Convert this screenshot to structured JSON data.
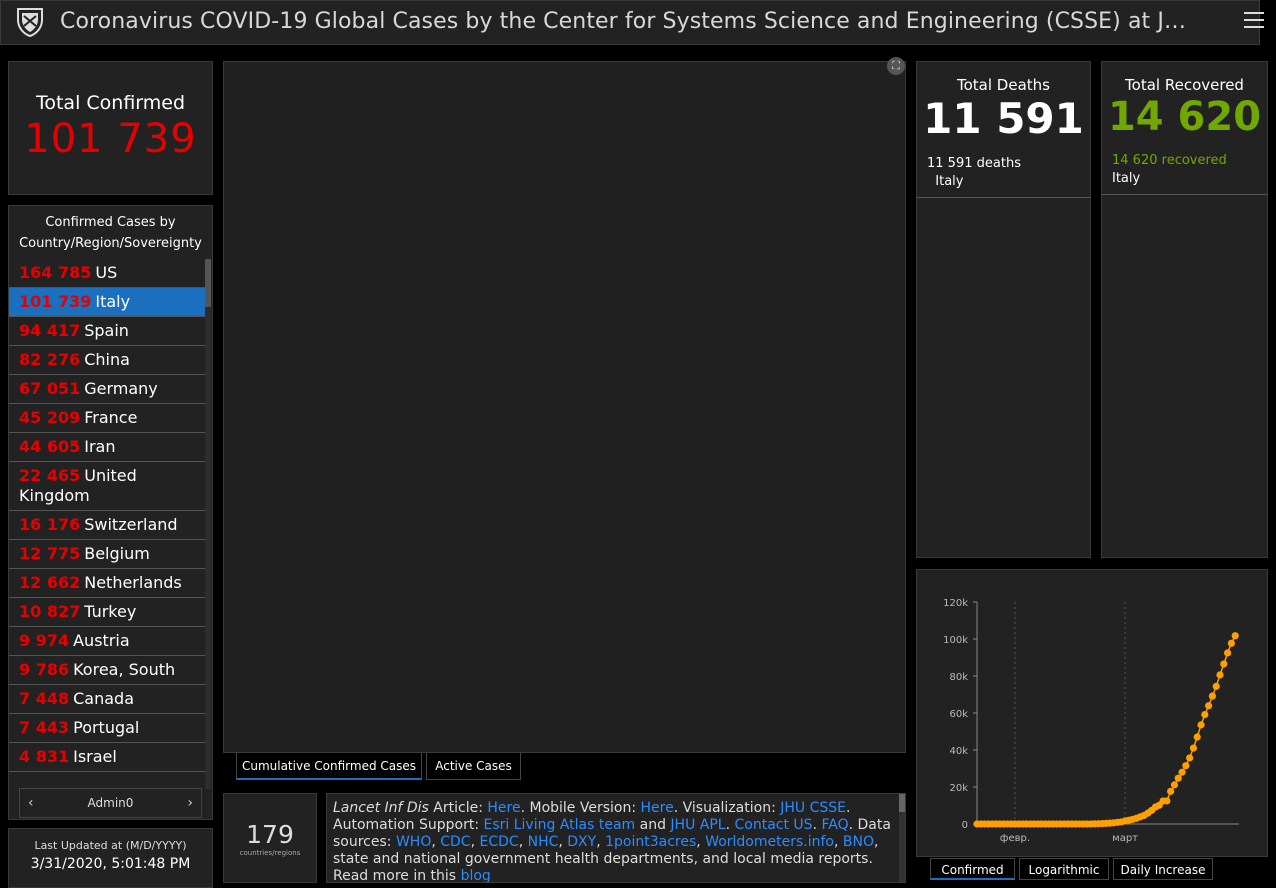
{
  "header": {
    "title": "Coronavirus COVID-19 Global Cases by the Center for Systems Science and Engineering (CSSE) at J…"
  },
  "total_confirmed": {
    "label": "Total Confirmed",
    "value": "101 739"
  },
  "country_list": {
    "header": "Confirmed Cases by Country/Region/Sovereignty",
    "items": [
      {
        "n": "164 785",
        "name": "US"
      },
      {
        "n": "101 739",
        "name": "Italy"
      },
      {
        "n": "94 417",
        "name": "Spain"
      },
      {
        "n": "82 276",
        "name": "China"
      },
      {
        "n": "67 051",
        "name": "Germany"
      },
      {
        "n": "45 209",
        "name": "France"
      },
      {
        "n": "44 605",
        "name": "Iran"
      },
      {
        "n": "22 465",
        "name": "United Kingdom"
      },
      {
        "n": "16 176",
        "name": "Switzerland"
      },
      {
        "n": "12 775",
        "name": "Belgium"
      },
      {
        "n": "12 662",
        "name": "Netherlands"
      },
      {
        "n": "10 827",
        "name": "Turkey"
      },
      {
        "n": "9 974",
        "name": "Austria"
      },
      {
        "n": "9 786",
        "name": "Korea, South"
      },
      {
        "n": "7 448",
        "name": "Canada"
      },
      {
        "n": "7 443",
        "name": "Portugal"
      },
      {
        "n": "4 831",
        "name": "Israel"
      }
    ],
    "selected_index": 1,
    "pager_label": "Admin0"
  },
  "last_updated": {
    "label": "Last Updated at (M/D/YYYY)",
    "value": "3/31/2020, 5:01:48 PM"
  },
  "map_tabs": [
    "Cumulative Confirmed Cases",
    "Active Cases"
  ],
  "countries_count": {
    "value": "179",
    "label": "countries/regions"
  },
  "info": {
    "source_name": "Lancet Inf Dis",
    "t1": " Article: ",
    "l_here1": "Here",
    "t2": ". Mobile Version: ",
    "l_here2": "Here",
    "t3": ". Visualization: ",
    "l_jhu": "JHU CSSE",
    "t4": ". Automation Support: ",
    "l_esri": "Esri Living Atlas team",
    "t5": " and ",
    "l_apl": "JHU APL",
    "t6": ". ",
    "l_contact": "Contact US",
    "t7": ". ",
    "l_faq": "FAQ",
    "t8": ". Data sources: ",
    "l_who": "WHO",
    "l_cdc": "CDC",
    "l_ecdc": "ECDC",
    "l_nhc": "NHC",
    "l_dxy": "DXY",
    "l_1p3a": "1point3acres",
    "l_wom": "Worldometers.info",
    "l_bno": "BNO",
    "comma": ", ",
    "t9": ", state and national government health departments, and local media reports.  Read more in this ",
    "l_blog": "blog"
  },
  "total_deaths": {
    "label": "Total Deaths",
    "value": "11 591",
    "detail_value": "11 591",
    "detail_word": "deaths",
    "country": "Italy"
  },
  "total_recovered": {
    "label": "Total Recovered",
    "value": "14 620",
    "detail_value": "14 620",
    "detail_word": "recovered",
    "country": "Italy"
  },
  "chart_tabs": [
    "Confirmed",
    "Logarithmic",
    "Daily Increase"
  ],
  "colors": {
    "confirmed": "#e60000",
    "recovered": "#70a800",
    "accent": "#1a6fbf",
    "series": "#ff9f00"
  },
  "chart_data": {
    "type": "scatter",
    "ylim": [
      0,
      120000
    ],
    "yticks": [
      0,
      20000,
      40000,
      60000,
      80000,
      100000,
      120000
    ],
    "ytick_labels": [
      "0",
      "20k",
      "40k",
      "60k",
      "80k",
      "100k",
      "120k"
    ],
    "x_tick_labels": [
      {
        "date": "2020-02-01",
        "label": "февр."
      },
      {
        "date": "2020-03-01",
        "label": "март"
      }
    ],
    "x_range": [
      "2020-01-22",
      "2020-03-31"
    ],
    "series": [
      {
        "values": [
          {
            "x": "2020-01-22",
            "y": 0
          },
          {
            "x": "2020-01-23",
            "y": 0
          },
          {
            "x": "2020-01-24",
            "y": 0
          },
          {
            "x": "2020-01-25",
            "y": 0
          },
          {
            "x": "2020-01-26",
            "y": 0
          },
          {
            "x": "2020-01-27",
            "y": 0
          },
          {
            "x": "2020-01-28",
            "y": 0
          },
          {
            "x": "2020-01-29",
            "y": 0
          },
          {
            "x": "2020-01-30",
            "y": 0
          },
          {
            "x": "2020-01-31",
            "y": 2
          },
          {
            "x": "2020-02-01",
            "y": 2
          },
          {
            "x": "2020-02-02",
            "y": 2
          },
          {
            "x": "2020-02-03",
            "y": 2
          },
          {
            "x": "2020-02-04",
            "y": 2
          },
          {
            "x": "2020-02-05",
            "y": 2
          },
          {
            "x": "2020-02-06",
            "y": 2
          },
          {
            "x": "2020-02-07",
            "y": 3
          },
          {
            "x": "2020-02-08",
            "y": 3
          },
          {
            "x": "2020-02-09",
            "y": 3
          },
          {
            "x": "2020-02-10",
            "y": 3
          },
          {
            "x": "2020-02-11",
            "y": 3
          },
          {
            "x": "2020-02-12",
            "y": 3
          },
          {
            "x": "2020-02-13",
            "y": 3
          },
          {
            "x": "2020-02-14",
            "y": 3
          },
          {
            "x": "2020-02-15",
            "y": 3
          },
          {
            "x": "2020-02-16",
            "y": 3
          },
          {
            "x": "2020-02-17",
            "y": 3
          },
          {
            "x": "2020-02-18",
            "y": 3
          },
          {
            "x": "2020-02-19",
            "y": 3
          },
          {
            "x": "2020-02-20",
            "y": 3
          },
          {
            "x": "2020-02-21",
            "y": 20
          },
          {
            "x": "2020-02-22",
            "y": 62
          },
          {
            "x": "2020-02-23",
            "y": 155
          },
          {
            "x": "2020-02-24",
            "y": 229
          },
          {
            "x": "2020-02-25",
            "y": 322
          },
          {
            "x": "2020-02-26",
            "y": 453
          },
          {
            "x": "2020-02-27",
            "y": 655
          },
          {
            "x": "2020-02-28",
            "y": 888
          },
          {
            "x": "2020-02-29",
            "y": 1128
          },
          {
            "x": "2020-03-01",
            "y": 1694
          },
          {
            "x": "2020-03-02",
            "y": 2036
          },
          {
            "x": "2020-03-03",
            "y": 2502
          },
          {
            "x": "2020-03-04",
            "y": 3089
          },
          {
            "x": "2020-03-05",
            "y": 3858
          },
          {
            "x": "2020-03-06",
            "y": 4636
          },
          {
            "x": "2020-03-07",
            "y": 5883
          },
          {
            "x": "2020-03-08",
            "y": 7375
          },
          {
            "x": "2020-03-09",
            "y": 9172
          },
          {
            "x": "2020-03-10",
            "y": 10149
          },
          {
            "x": "2020-03-11",
            "y": 12462
          },
          {
            "x": "2020-03-12",
            "y": 12462
          },
          {
            "x": "2020-03-13",
            "y": 17660
          },
          {
            "x": "2020-03-14",
            "y": 21157
          },
          {
            "x": "2020-03-15",
            "y": 24747
          },
          {
            "x": "2020-03-16",
            "y": 27980
          },
          {
            "x": "2020-03-17",
            "y": 31506
          },
          {
            "x": "2020-03-18",
            "y": 35713
          },
          {
            "x": "2020-03-19",
            "y": 41035
          },
          {
            "x": "2020-03-20",
            "y": 47021
          },
          {
            "x": "2020-03-21",
            "y": 53578
          },
          {
            "x": "2020-03-22",
            "y": 59138
          },
          {
            "x": "2020-03-23",
            "y": 63927
          },
          {
            "x": "2020-03-24",
            "y": 69176
          },
          {
            "x": "2020-03-25",
            "y": 74386
          },
          {
            "x": "2020-03-26",
            "y": 80589
          },
          {
            "x": "2020-03-27",
            "y": 86498
          },
          {
            "x": "2020-03-28",
            "y": 92472
          },
          {
            "x": "2020-03-29",
            "y": 97689
          },
          {
            "x": "2020-03-30",
            "y": 101739
          }
        ]
      }
    ]
  }
}
